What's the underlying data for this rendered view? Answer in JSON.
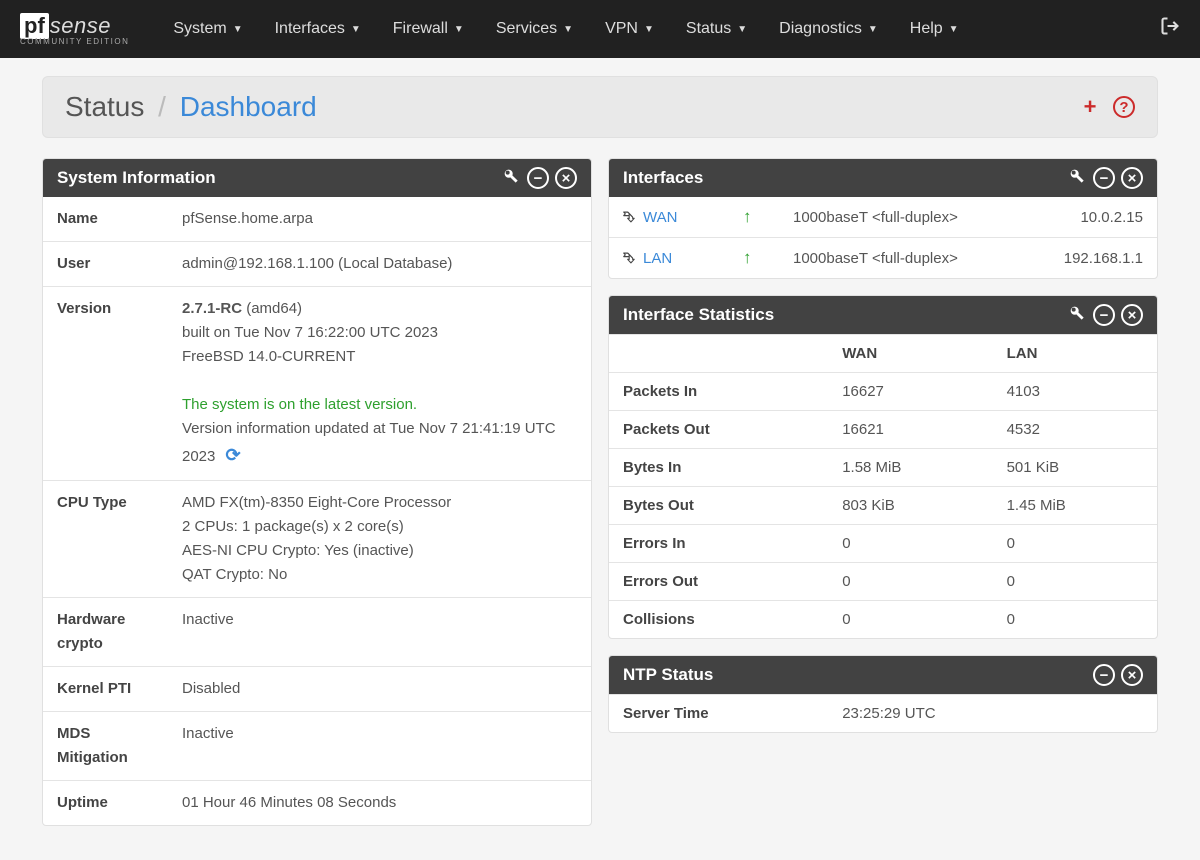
{
  "brand": {
    "pf": "pf",
    "sense": "sense",
    "sub": "COMMUNITY EDITION"
  },
  "nav": [
    "System",
    "Interfaces",
    "Firewall",
    "Services",
    "VPN",
    "Status",
    "Diagnostics",
    "Help"
  ],
  "breadcrumb": {
    "main": "Status",
    "sep": "/",
    "active": "Dashboard"
  },
  "sysinfo": {
    "title": "System Information",
    "labels": {
      "name": "Name",
      "user": "User",
      "version": "Version",
      "cpu": "CPU Type",
      "hw": "Hardware crypto",
      "pti": "Kernel PTI",
      "mds": "MDS Mitigation",
      "uptime": "Uptime"
    },
    "name": "pfSense.home.arpa",
    "user": "admin@192.168.1.100 (Local Database)",
    "version_main": "2.7.1-RC",
    "version_arch": " (amd64)",
    "version_built": "built on Tue Nov 7 16:22:00 UTC 2023",
    "version_os": "FreeBSD 14.0-CURRENT",
    "version_status": "The system is on the latest version.",
    "version_updated": "Version information updated at Tue Nov 7 21:41:19 UTC 2023",
    "cpu_model": "AMD FX(tm)-8350 Eight-Core Processor",
    "cpu_cores": "2 CPUs: 1 package(s) x 2 core(s)",
    "cpu_aesni": "AES-NI CPU Crypto: Yes (inactive)",
    "cpu_qat": "QAT Crypto: No",
    "hw": "Inactive",
    "pti": "Disabled",
    "mds": "Inactive",
    "uptime": "01 Hour 46 Minutes 08 Seconds"
  },
  "interfaces": {
    "title": "Interfaces",
    "rows": [
      {
        "name": "WAN",
        "media": "1000baseT <full-duplex>",
        "ip": "10.0.2.15"
      },
      {
        "name": "LAN",
        "media": "1000baseT <full-duplex>",
        "ip": "192.168.1.1"
      }
    ]
  },
  "ifstats": {
    "title": "Interface Statistics",
    "cols": [
      "",
      "WAN",
      "LAN"
    ],
    "rows": [
      {
        "lbl": "Packets In",
        "wan": "16627",
        "lan": "4103"
      },
      {
        "lbl": "Packets Out",
        "wan": "16621",
        "lan": "4532"
      },
      {
        "lbl": "Bytes In",
        "wan": "1.58 MiB",
        "lan": "501 KiB"
      },
      {
        "lbl": "Bytes Out",
        "wan": "803 KiB",
        "lan": "1.45 MiB"
      },
      {
        "lbl": "Errors In",
        "wan": "0",
        "lan": "0"
      },
      {
        "lbl": "Errors Out",
        "wan": "0",
        "lan": "0"
      },
      {
        "lbl": "Collisions",
        "wan": "0",
        "lan": "0"
      }
    ]
  },
  "ntp": {
    "title": "NTP Status",
    "server_time_lbl": "Server Time",
    "server_time": "23:25:29 UTC"
  }
}
